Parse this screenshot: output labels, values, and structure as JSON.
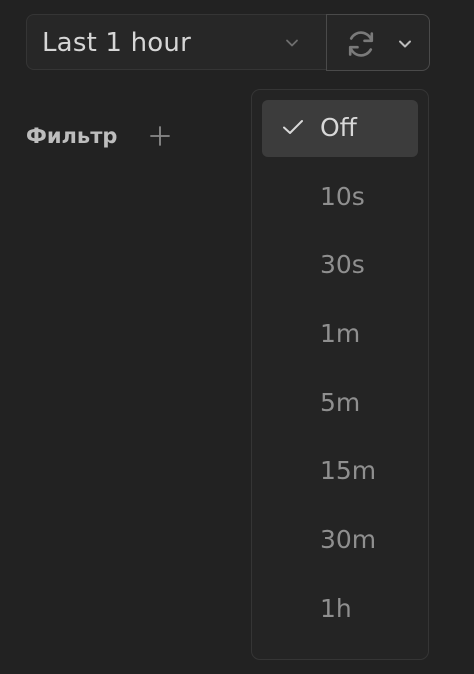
{
  "time_picker": {
    "label": "Last 1 hour",
    "chevron_icon": "chevron-down-icon"
  },
  "refresh": {
    "icon": "refresh-icon",
    "chevron_icon": "chevron-down-icon"
  },
  "filter": {
    "label": "Фильтр",
    "add_icon": "plus-icon"
  },
  "refresh_menu": {
    "selected": "Off",
    "check_icon": "check-icon",
    "options": [
      "Off",
      "10s",
      "30s",
      "1m",
      "5m",
      "15m",
      "30m",
      "1h"
    ]
  }
}
